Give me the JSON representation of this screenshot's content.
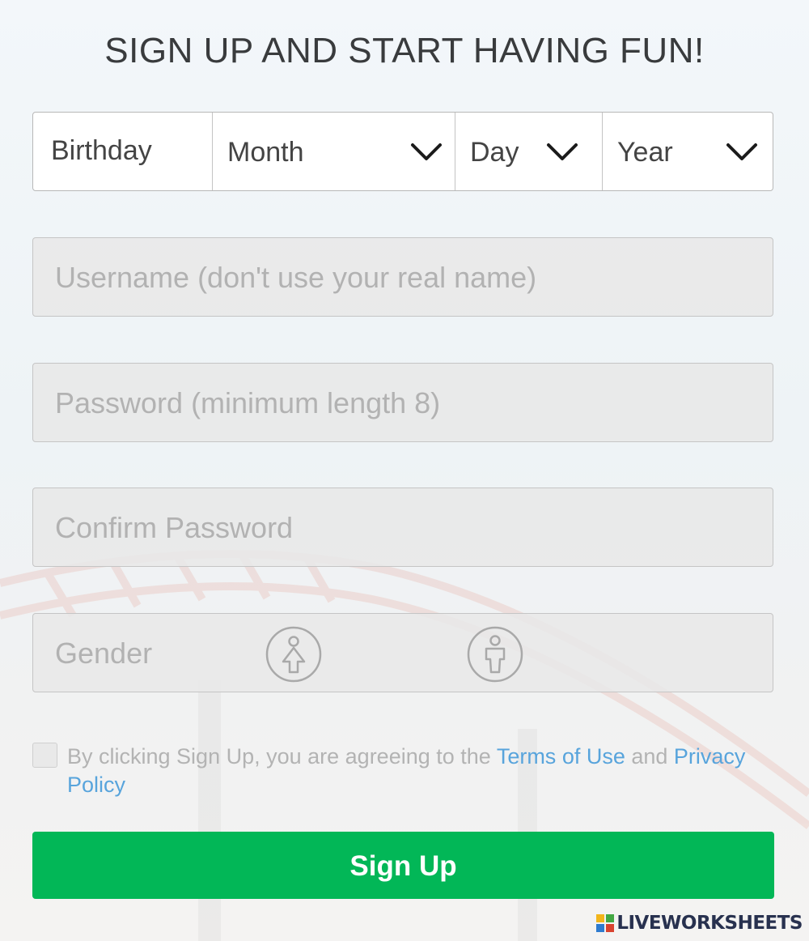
{
  "page": {
    "title": "SIGN UP AND START HAVING FUN!"
  },
  "birthday": {
    "label": "Birthday",
    "month": "Month",
    "day": "Day",
    "year": "Year"
  },
  "fields": {
    "username_placeholder": "Username (don't use your real name)",
    "password_placeholder": "Password (minimum length 8)",
    "confirm_placeholder": "Confirm Password",
    "gender_label": "Gender"
  },
  "gender_icons": [
    "female-icon",
    "male-icon"
  ],
  "terms": {
    "prefix": "By clicking Sign Up, you are agreeing to the ",
    "terms_link": "Terms of Use",
    "middle": " and ",
    "privacy_link": "Privacy Policy",
    "checked": false
  },
  "signup_button": "Sign Up",
  "watermark": "LIVEWORKSHEETS",
  "colors": {
    "primary_button": "#02b757",
    "link": "#58a4dc",
    "title_text": "#393b3d",
    "placeholder_text": "#b2b2b2"
  }
}
